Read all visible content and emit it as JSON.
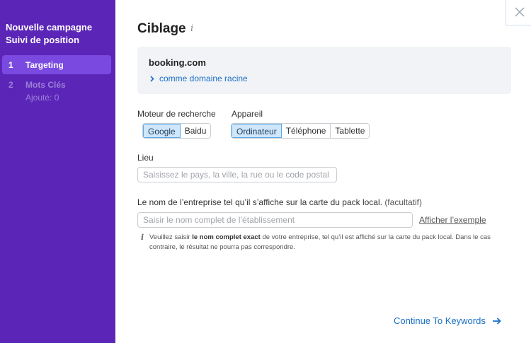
{
  "sidebar": {
    "title_line1": "Nouvelle campagne",
    "title_line2": "Suivi de position",
    "steps": [
      {
        "num": "1",
        "label": "Targeting",
        "sub": ""
      },
      {
        "num": "2",
        "label": "Mots Clés",
        "sub": "Ajouté: 0"
      }
    ]
  },
  "header": {
    "title": "Ciblage",
    "info_glyph": "i"
  },
  "domain": {
    "name": "booking.com",
    "mode": "comme domaine racine"
  },
  "engine": {
    "label": "Moteur de recherche",
    "options": [
      "Google",
      "Baidu"
    ],
    "selected": "Google"
  },
  "device": {
    "label": "Appareil",
    "options": [
      "Ordinateur",
      "Téléphone",
      "Tablette"
    ],
    "selected": "Ordinateur"
  },
  "location": {
    "label": "Lieu",
    "placeholder": "Saisissez le pays, la ville, la rue ou le code postal"
  },
  "business": {
    "label": "Le nom de l’entreprise tel qu’il s’affiche sur la carte du pack local.",
    "optional": "(facultatif)",
    "placeholder": "Saisir le nom complet de l’établissement",
    "example_link": "Afficher l’exemple",
    "hint_prefix": "Veuillez saisir ",
    "hint_bold": "le nom complet exact",
    "hint_suffix": " de votre entreprise, tel qu’il est affiché sur la carte du pack local. Dans le cas contraire, le résultat ne pourra pas correspondre."
  },
  "footer": {
    "continue_label": "Continue To Keywords"
  },
  "colors": {
    "sidebar_bg": "#5b26b8",
    "active_step_bg": "#7a4ae0",
    "link": "#1a6fc4",
    "selected_bg": "#cfe6fb"
  }
}
